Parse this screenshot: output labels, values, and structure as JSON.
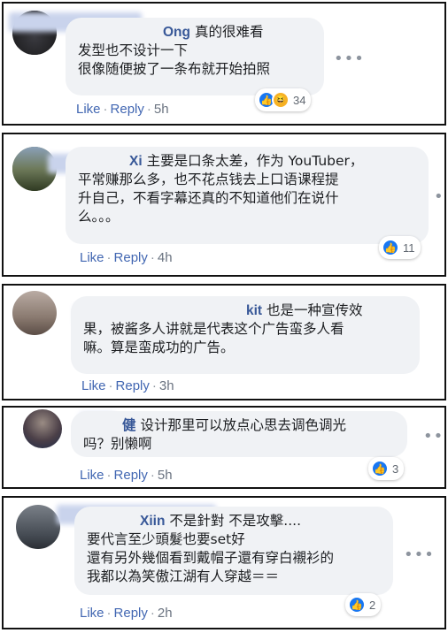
{
  "comments": [
    {
      "author": "Ong",
      "text_lines": [
        "真的很难看",
        "发型也不设计一下",
        "很像随便披了一条布就开始拍照"
      ],
      "like": "Like",
      "reply": "Reply",
      "time": "5h",
      "reactions": [
        "like-icon",
        "haha-icon"
      ],
      "reaction_count": "34"
    },
    {
      "author": "Xi",
      "text_lines": [
        "主要是口条太差，作为 YouTuber，",
        "平常赚那么多，也不花点钱去上口语课程提",
        "升自己，不看字幕还真的不知道他们在说什",
        "么。。。"
      ],
      "like": "Like",
      "reply": "Reply",
      "time": "4h",
      "reactions": [
        "like-icon"
      ],
      "reaction_count": "11"
    },
    {
      "author": "kit",
      "text_lines": [
        "也是一种宣传效",
        "果，被酱多人讲就是代表这个广告蛮多人看",
        "嘛。算是蛮成功的广告。"
      ],
      "like": "Like",
      "reply": "Reply",
      "time": "3h"
    },
    {
      "author": "健",
      "text_lines": [
        "设计那里可以放点心思去调色调光",
        "吗？别懒啊"
      ],
      "like": "Like",
      "reply": "Reply",
      "time": "5h",
      "reactions": [
        "like-icon"
      ],
      "reaction_count": "3"
    },
    {
      "author": "Xiin",
      "text_lines": [
        "不是針對 不是攻擊....",
        "要代言至少頭髮也要set好",
        "還有另外幾個看到戴帽子還有穿白襯衫的",
        "我都以為笑傲江湖有人穿越＝＝"
      ],
      "like": "Like",
      "reply": "Reply",
      "time": "2h",
      "reactions": [
        "like-icon"
      ],
      "reaction_count": "2"
    }
  ],
  "colors": {
    "link": "#4267b2",
    "author": "#385898",
    "bubble": "#f0f2f5",
    "like": "#1877f2",
    "haha": "#f7b125"
  }
}
